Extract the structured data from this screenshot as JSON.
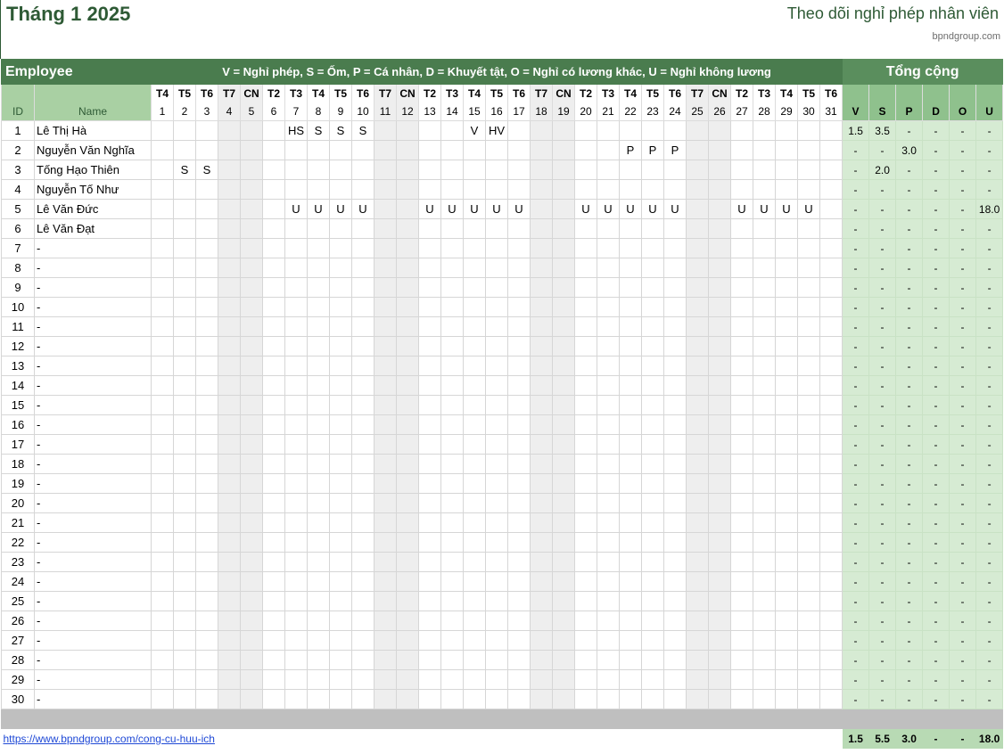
{
  "title": "Tháng 1 2025",
  "subtitle": "Theo dõi nghỉ phép nhân viên",
  "site": "bpndgroup.com",
  "header": {
    "employee": "Employee",
    "legend": "V = Nghỉ phép, S = Ốm, P = Cá nhân, D = Khuyết tật, O = Nghỉ có lương khác, U = Nghỉ không lương",
    "total": "Tổng cộng",
    "id": "ID",
    "name": "Name",
    "codes": [
      "V",
      "S",
      "P",
      "D",
      "O",
      "U"
    ]
  },
  "days": [
    {
      "d": "1",
      "w": "T4"
    },
    {
      "d": "2",
      "w": "T5"
    },
    {
      "d": "3",
      "w": "T6"
    },
    {
      "d": "4",
      "w": "T7"
    },
    {
      "d": "5",
      "w": "CN"
    },
    {
      "d": "6",
      "w": "T2"
    },
    {
      "d": "7",
      "w": "T3"
    },
    {
      "d": "8",
      "w": "T4"
    },
    {
      "d": "9",
      "w": "T5"
    },
    {
      "d": "10",
      "w": "T6"
    },
    {
      "d": "11",
      "w": "T7"
    },
    {
      "d": "12",
      "w": "CN"
    },
    {
      "d": "13",
      "w": "T2"
    },
    {
      "d": "14",
      "w": "T3"
    },
    {
      "d": "15",
      "w": "T4"
    },
    {
      "d": "16",
      "w": "T5"
    },
    {
      "d": "17",
      "w": "T6"
    },
    {
      "d": "18",
      "w": "T7"
    },
    {
      "d": "19",
      "w": "CN"
    },
    {
      "d": "20",
      "w": "T2"
    },
    {
      "d": "21",
      "w": "T3"
    },
    {
      "d": "22",
      "w": "T4"
    },
    {
      "d": "23",
      "w": "T5"
    },
    {
      "d": "24",
      "w": "T6"
    },
    {
      "d": "25",
      "w": "T7"
    },
    {
      "d": "26",
      "w": "CN"
    },
    {
      "d": "27",
      "w": "T2"
    },
    {
      "d": "28",
      "w": "T3"
    },
    {
      "d": "29",
      "w": "T4"
    },
    {
      "d": "30",
      "w": "T5"
    },
    {
      "d": "31",
      "w": "T6"
    }
  ],
  "weekend_days": [
    "4",
    "5",
    "11",
    "12",
    "18",
    "19",
    "25",
    "26"
  ],
  "employees": [
    {
      "id": "1",
      "name": "Lê Thị Hà",
      "leave": {
        "7": "HS",
        "8": "S",
        "9": "S",
        "10": "S",
        "15": "V",
        "16": "HV"
      },
      "totals": [
        "1.5",
        "3.5",
        "-",
        "-",
        "-",
        "-"
      ]
    },
    {
      "id": "2",
      "name": "Nguyễn Văn Nghĩa",
      "leave": {
        "22": "P",
        "23": "P",
        "24": "P"
      },
      "totals": [
        "-",
        "-",
        "3.0",
        "-",
        "-",
        "-"
      ]
    },
    {
      "id": "3",
      "name": "Tống Hạo Thiên",
      "leave": {
        "2": "S",
        "3": "S"
      },
      "totals": [
        "-",
        "2.0",
        "-",
        "-",
        "-",
        "-"
      ]
    },
    {
      "id": "4",
      "name": "Nguyễn Tố Như",
      "leave": {},
      "totals": [
        "-",
        "-",
        "-",
        "-",
        "-",
        "-"
      ]
    },
    {
      "id": "5",
      "name": "Lê Văn Đức",
      "leave": {
        "7": "U",
        "8": "U",
        "9": "U",
        "10": "U",
        "13": "U",
        "14": "U",
        "15": "U",
        "16": "U",
        "17": "U",
        "20": "U",
        "21": "U",
        "22": "U",
        "23": "U",
        "24": "U",
        "27": "U",
        "28": "U",
        "29": "U",
        "30": "U"
      },
      "totals": [
        "-",
        "-",
        "-",
        "-",
        "-",
        "18.0"
      ]
    },
    {
      "id": "6",
      "name": "Lê Văn Đạt",
      "leave": {},
      "totals": [
        "-",
        "-",
        "-",
        "-",
        "-",
        "-"
      ]
    },
    {
      "id": "7",
      "name": "-",
      "leave": {},
      "totals": [
        "-",
        "-",
        "-",
        "-",
        "-",
        "-"
      ]
    },
    {
      "id": "8",
      "name": "-",
      "leave": {},
      "totals": [
        "-",
        "-",
        "-",
        "-",
        "-",
        "-"
      ]
    },
    {
      "id": "9",
      "name": "-",
      "leave": {},
      "totals": [
        "-",
        "-",
        "-",
        "-",
        "-",
        "-"
      ]
    },
    {
      "id": "10",
      "name": "-",
      "leave": {},
      "totals": [
        "-",
        "-",
        "-",
        "-",
        "-",
        "-"
      ]
    },
    {
      "id": "11",
      "name": "-",
      "leave": {},
      "totals": [
        "-",
        "-",
        "-",
        "-",
        "-",
        "-"
      ]
    },
    {
      "id": "12",
      "name": "-",
      "leave": {},
      "totals": [
        "-",
        "-",
        "-",
        "-",
        "-",
        "-"
      ]
    },
    {
      "id": "13",
      "name": "-",
      "leave": {},
      "totals": [
        "-",
        "-",
        "-",
        "-",
        "-",
        "-"
      ]
    },
    {
      "id": "14",
      "name": "-",
      "leave": {},
      "totals": [
        "-",
        "-",
        "-",
        "-",
        "-",
        "-"
      ]
    },
    {
      "id": "15",
      "name": "-",
      "leave": {},
      "totals": [
        "-",
        "-",
        "-",
        "-",
        "-",
        "-"
      ]
    },
    {
      "id": "16",
      "name": "-",
      "leave": {},
      "totals": [
        "-",
        "-",
        "-",
        "-",
        "-",
        "-"
      ]
    },
    {
      "id": "17",
      "name": "-",
      "leave": {},
      "totals": [
        "-",
        "-",
        "-",
        "-",
        "-",
        "-"
      ]
    },
    {
      "id": "18",
      "name": "-",
      "leave": {},
      "totals": [
        "-",
        "-",
        "-",
        "-",
        "-",
        "-"
      ]
    },
    {
      "id": "19",
      "name": "-",
      "leave": {},
      "totals": [
        "-",
        "-",
        "-",
        "-",
        "-",
        "-"
      ]
    },
    {
      "id": "20",
      "name": "-",
      "leave": {},
      "totals": [
        "-",
        "-",
        "-",
        "-",
        "-",
        "-"
      ]
    },
    {
      "id": "21",
      "name": "-",
      "leave": {},
      "totals": [
        "-",
        "-",
        "-",
        "-",
        "-",
        "-"
      ]
    },
    {
      "id": "22",
      "name": "-",
      "leave": {},
      "totals": [
        "-",
        "-",
        "-",
        "-",
        "-",
        "-"
      ]
    },
    {
      "id": "23",
      "name": "-",
      "leave": {},
      "totals": [
        "-",
        "-",
        "-",
        "-",
        "-",
        "-"
      ]
    },
    {
      "id": "24",
      "name": "-",
      "leave": {},
      "totals": [
        "-",
        "-",
        "-",
        "-",
        "-",
        "-"
      ]
    },
    {
      "id": "25",
      "name": "-",
      "leave": {},
      "totals": [
        "-",
        "-",
        "-",
        "-",
        "-",
        "-"
      ]
    },
    {
      "id": "26",
      "name": "-",
      "leave": {},
      "totals": [
        "-",
        "-",
        "-",
        "-",
        "-",
        "-"
      ]
    },
    {
      "id": "27",
      "name": "-",
      "leave": {},
      "totals": [
        "-",
        "-",
        "-",
        "-",
        "-",
        "-"
      ]
    },
    {
      "id": "28",
      "name": "-",
      "leave": {},
      "totals": [
        "-",
        "-",
        "-",
        "-",
        "-",
        "-"
      ]
    },
    {
      "id": "29",
      "name": "-",
      "leave": {},
      "totals": [
        "-",
        "-",
        "-",
        "-",
        "-",
        "-"
      ]
    },
    {
      "id": "30",
      "name": "-",
      "leave": {},
      "totals": [
        "-",
        "-",
        "-",
        "-",
        "-",
        "-"
      ]
    }
  ],
  "footer": {
    "link": "https://www.bpndgroup.com/cong-cu-huu-ich",
    "totals": [
      "1.5",
      "5.5",
      "3.0",
      "-",
      "-",
      "18.0"
    ]
  },
  "colors": {
    "header_green": "#4a7c4e",
    "title_green": "#2e5a35",
    "summary_green": "#d6ebd3",
    "weekend_gray": "#eeeeee"
  }
}
